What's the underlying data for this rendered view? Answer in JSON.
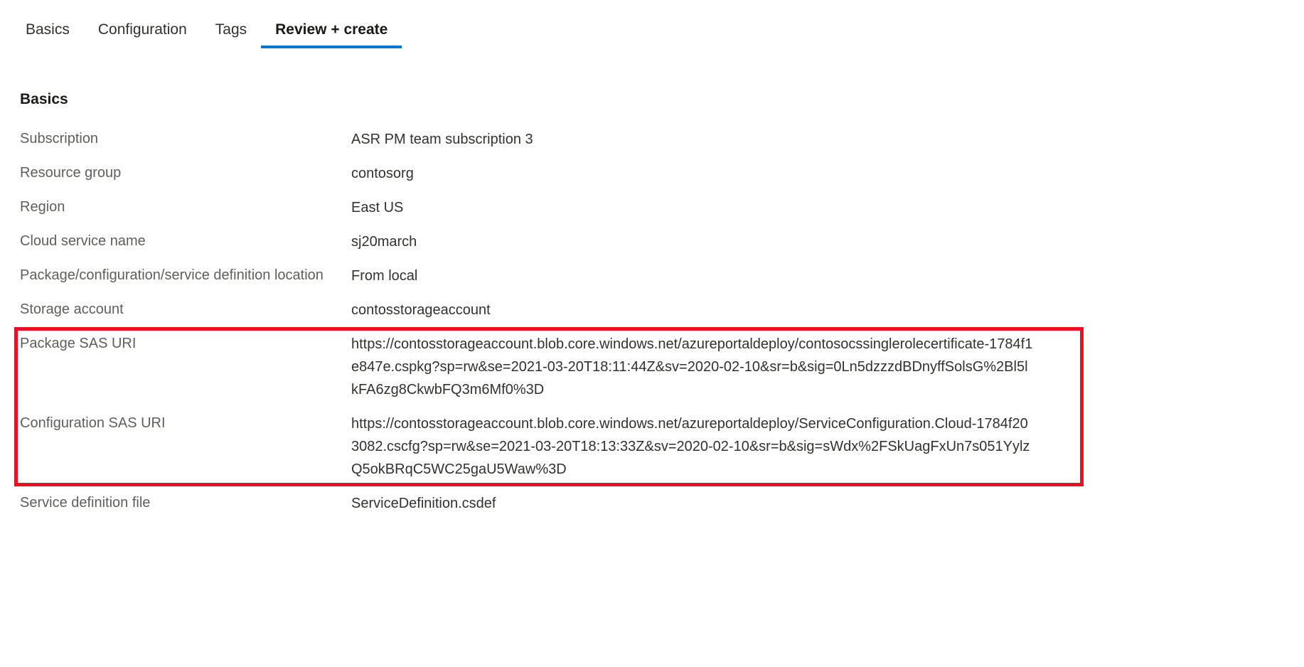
{
  "tabs": {
    "basics": "Basics",
    "configuration": "Configuration",
    "tags": "Tags",
    "review_create": "Review + create"
  },
  "section": {
    "title": "Basics"
  },
  "fields": {
    "subscription": {
      "label": "Subscription",
      "value": "ASR PM team subscription 3"
    },
    "resource_group": {
      "label": "Resource group",
      "value": "contosorg"
    },
    "region": {
      "label": "Region",
      "value": "East US"
    },
    "cloud_service_name": {
      "label": "Cloud service name",
      "value": "sj20march"
    },
    "package_location": {
      "label": "Package/configuration/service definition location",
      "value": "From local"
    },
    "storage_account": {
      "label": "Storage account",
      "value": "contosstorageaccount"
    },
    "package_sas_uri": {
      "label": "Package SAS URI",
      "value": "https://contosstorageaccount.blob.core.windows.net/azureportaldeploy/contosocssinglerolecertificate-1784f1e847e.cspkg?sp=rw&se=2021-03-20T18:11:44Z&sv=2020-02-10&sr=b&sig=0Ln5dzzzdBDnyffSolsG%2Bl5lkFA6zg8CkwbFQ3m6Mf0%3D"
    },
    "configuration_sas_uri": {
      "label": "Configuration SAS URI",
      "value": "https://contosstorageaccount.blob.core.windows.net/azureportaldeploy/ServiceConfiguration.Cloud-1784f203082.cscfg?sp=rw&se=2021-03-20T18:13:33Z&sv=2020-02-10&sr=b&sig=sWdx%2FSkUagFxUn7s051YylzQ5okBRqC5WC25gaU5Waw%3D"
    },
    "service_definition_file": {
      "label": "Service definition file",
      "value": "ServiceDefinition.csdef"
    }
  }
}
